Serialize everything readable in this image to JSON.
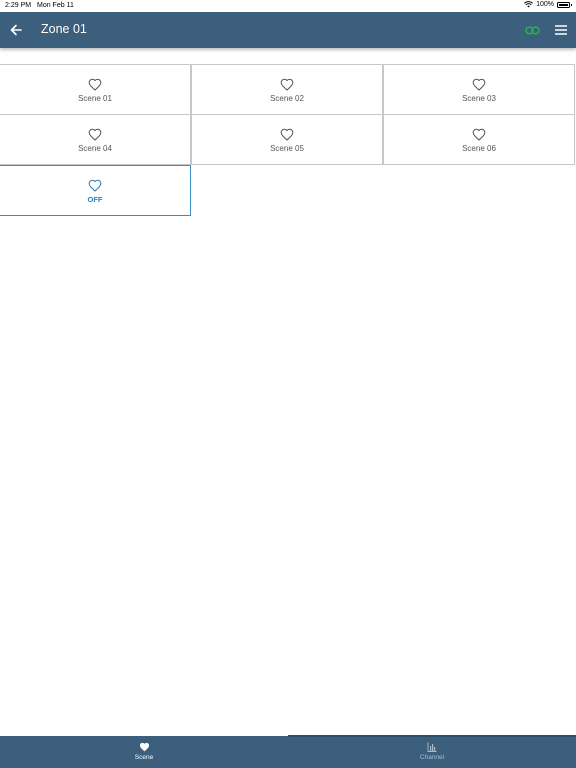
{
  "status_bar": {
    "time": "2:29 PM",
    "date": "Mon Feb 11",
    "battery": "100%"
  },
  "app_bar": {
    "title": "Zone 01",
    "back_icon": "arrow-left-icon",
    "link_icon": "link-icon",
    "menu_icon": "hamburger-menu-icon"
  },
  "scenes": [
    {
      "label": "Scene 01"
    },
    {
      "label": "Scene 02"
    },
    {
      "label": "Scene 03"
    },
    {
      "label": "Scene 04"
    },
    {
      "label": "Scene 05"
    },
    {
      "label": "Scene 06"
    },
    {
      "label": "OFF"
    }
  ],
  "bottom_nav": {
    "tabs": [
      {
        "label": "Scene",
        "icon": "heart-icon",
        "active": true
      },
      {
        "label": "Channel",
        "icon": "bar-chart-icon",
        "active": false
      }
    ]
  },
  "colors": {
    "app_bar": "#3b5f7d",
    "link_icon": "#27b24a",
    "off_accent": "#2a7fbf",
    "tile_border": "#c8c8c8"
  }
}
